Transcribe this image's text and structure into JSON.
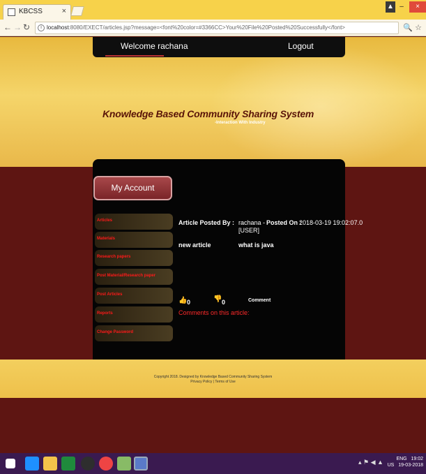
{
  "browser": {
    "tab_title": "KBCSS",
    "url_host": "localhost",
    "url_rest": ":8080/EXECT/articles.jsp?message=<font%20color=#3366CC>Your%20File%20Posted%20Successfully</font>"
  },
  "menu": {
    "welcome": "Welcome  rachana",
    "logout": "Logout"
  },
  "header": {
    "title": "Knowledge Based Community Sharing System",
    "tagline": "-Interaction With Industry"
  },
  "sidebar": {
    "my_account": "My Account",
    "items": [
      {
        "label": "Articles"
      },
      {
        "label": "Materials"
      },
      {
        "label": "Research papers"
      },
      {
        "label": "Post Material/Research paper"
      },
      {
        "label": "Post Articles"
      },
      {
        "label": "Reports"
      },
      {
        "label": "Change Password"
      }
    ]
  },
  "article": {
    "posted_by_label": "Article Posted By :",
    "posted_by_value_1": "rachana -",
    "posted_by_value_2": "[USER]",
    "posted_on_label": "Posted On :",
    "posted_on_value": "2018-03-19 19:02:07.0",
    "title": "new article",
    "body": "what is java",
    "likes": "0",
    "dislikes": "0",
    "comment_link": "Comment",
    "comments_heading": "Comments on this article:"
  },
  "footer": {
    "line1": "Copyright 2018. Designed by Knowledge Based Community Sharing System",
    "line2": "Privacy Policy | Terms of Use"
  },
  "tray": {
    "lang1": "ENG",
    "lang2": "US",
    "time": "19:02",
    "date": "19-03-2018"
  }
}
